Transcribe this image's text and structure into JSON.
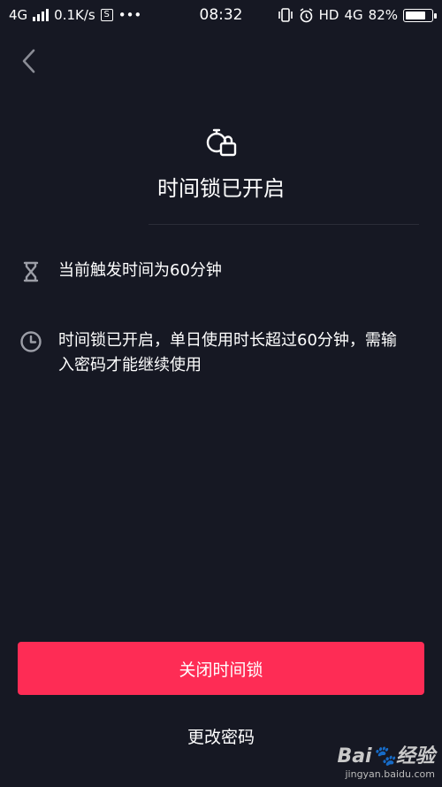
{
  "status_bar": {
    "network": "4G",
    "speed": "0.1K/s",
    "s_badge": "S",
    "dots": "•••",
    "time": "08:32",
    "hd": "HD",
    "network_right": "4G",
    "battery_percent": "82%",
    "battery_level": 0.82
  },
  "header": {
    "back_icon": "chevron-left-icon",
    "lock_icon": "timer-lock-icon",
    "title": "时间锁已开启"
  },
  "info": [
    {
      "icon": "hourglass-icon",
      "text": "当前触发时间为60分钟"
    },
    {
      "icon": "clock-icon",
      "text": "时间锁已开启，单日使用时长超过60分钟，需输入密码才能继续使用"
    }
  ],
  "actions": {
    "close_lock": "关闭时间锁",
    "change_password": "更改密码"
  },
  "watermark": {
    "logo": "Bai🐾经验",
    "url": "jingyan.baidu.com"
  },
  "colors": {
    "background": "#161823",
    "accent": "#fe2c55",
    "text": "#ffffff",
    "icon": "#9c9ea7"
  }
}
